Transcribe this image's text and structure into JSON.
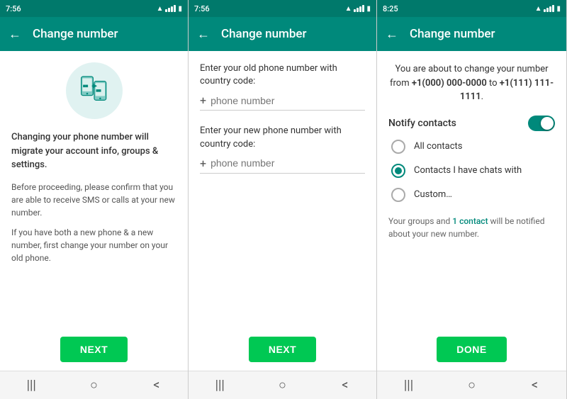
{
  "panels": [
    {
      "id": "panel1",
      "status_time": "7:56",
      "app_bar_title": "Change number",
      "main_text": "Changing your phone number will migrate your account info, groups & settings.",
      "sub_text_1": "Before proceeding, please confirm that you are able to receive SMS or calls at your new number.",
      "sub_text_2": "If you have both a new phone & a new number, first change your number on your old phone.",
      "button_label": "NEXT"
    },
    {
      "id": "panel2",
      "status_time": "7:56",
      "app_bar_title": "Change number",
      "old_label": "Enter your old phone number with country code:",
      "old_placeholder": "phone number",
      "new_label": "Enter your new phone number with country code:",
      "new_placeholder": "phone number",
      "button_label": "NEXT"
    },
    {
      "id": "panel3",
      "status_time": "8:25",
      "app_bar_title": "Change number",
      "info_text_prefix": "You are about to change your number from ",
      "old_number": "+1(000) 000-0000",
      "info_text_middle": " to ",
      "new_number": "+1(111) 111-1111",
      "info_text_suffix": ".",
      "notify_label": "Notify contacts",
      "toggle_on": true,
      "radio_options": [
        {
          "label": "All contacts",
          "selected": false
        },
        {
          "label": "Contacts I have chats with",
          "selected": true
        },
        {
          "label": "Custom…",
          "selected": false
        }
      ],
      "groups_text_prefix": "Your groups and ",
      "contact_link_text": "1 contact",
      "groups_text_suffix": " will be notified about your new number.",
      "button_label": "DONE"
    }
  ],
  "nav": {
    "menu_icon": "|||",
    "home_icon": "○",
    "back_icon": "<"
  }
}
